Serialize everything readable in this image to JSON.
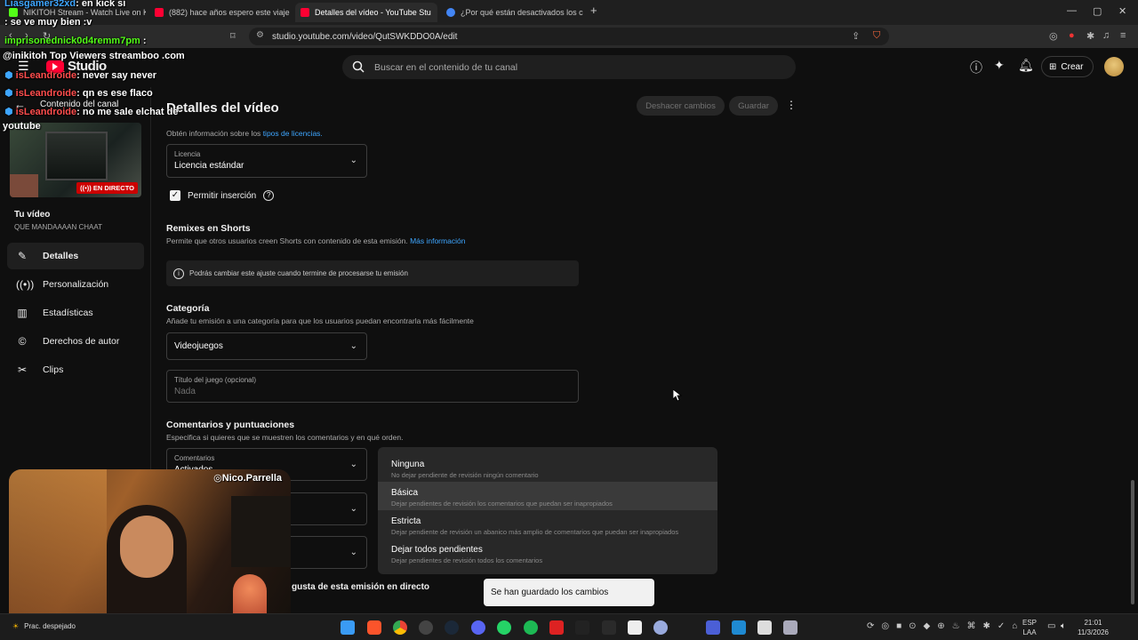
{
  "browser": {
    "tabs": [
      {
        "label": "NIKITOH Stream - Watch Live on Kick"
      },
      {
        "label": "(882) hace años espero este viaje - c"
      },
      {
        "label": "Detalles del vídeo - YouTube Stu"
      },
      {
        "label": "¿Por qué están desactivados los com"
      }
    ],
    "url": "studio.youtube.com/video/QutSWKDDO0A/edit"
  },
  "header": {
    "logo_text": "Studio",
    "search_placeholder": "Buscar en el contenido de tu canal",
    "create_label": "Crear"
  },
  "sidebar": {
    "back_label": "Contenido del canal",
    "live_badge": "EN DIRECTO",
    "your_video_label": "Tu vídeo",
    "video_title": "QUE MANDAAAAN CHAAT",
    "items": [
      {
        "label": "Detalles",
        "icon": "pencil-icon"
      },
      {
        "label": "Personalización",
        "icon": "broadcast-icon"
      },
      {
        "label": "Estadísticas",
        "icon": "analytics-icon"
      },
      {
        "label": "Derechos de autor",
        "icon": "copyright-icon"
      },
      {
        "label": "Clips",
        "icon": "scissors-icon"
      }
    ]
  },
  "main": {
    "page_title": "Detalles del vídeo",
    "undo_label": "Deshacer cambios",
    "save_label": "Guardar",
    "license_info_prefix": "Obtén información sobre los",
    "license_info_link": "tipos de licencias.",
    "license": {
      "label": "Licencia",
      "value": "Licencia estándar"
    },
    "embed_label": "Permitir inserción",
    "remix": {
      "title": "Remixes en Shorts",
      "desc": "Permite que otros usuarios creen Shorts con contenido de esta emisión.",
      "link": "Más información",
      "notice": "Podrás cambiar este ajuste cuando termine de procesarse tu emisión"
    },
    "category": {
      "title": "Categoría",
      "desc": "Añade tu emisión a una categoría para que los usuarios puedan encontrarla más fácilmente",
      "value": "Videojuegos",
      "game_label": "Título del juego (opcional)",
      "game_placeholder": "Nada"
    },
    "comments": {
      "title": "Comentarios y puntuaciones",
      "desc": "Especifica si quieres que se muestren los comentarios y en qué orden.",
      "field_label": "Comentarios",
      "field_value": "Activados",
      "likes_text": "gusta de esta emisión en directo"
    }
  },
  "moderation_menu": [
    {
      "title": "Ninguna",
      "desc": "No dejar pendiente de revisión ningún comentario"
    },
    {
      "title": "Básica",
      "desc": "Dejar pendientes de revisión los comentarios que puedan ser inapropiados"
    },
    {
      "title": "Estricta",
      "desc": "Dejar pendiente de revisión un abanico más amplio de comentarios que puedan ser inapropiados"
    },
    {
      "title": "Dejar todos pendientes",
      "desc": "Dejar pendientes de revisión todos los comentarios"
    }
  ],
  "toast": "Se han guardado los cambios",
  "chat_overlay": [
    {
      "user": "Liasgamer32xd",
      "msg": ": en kick si"
    },
    {
      "user": "",
      "msg": ": se ve muy bien :v"
    },
    {
      "user": "imprisonednick0d4remm7pm",
      "msg": " :"
    },
    {
      "user": "",
      "msg": "@inikitoh Top Viewers streamboo .com"
    },
    {
      "user": "isLeandroide",
      "msg": ": never say never"
    },
    {
      "user": "isLeandroide",
      "msg": ": qn es ese flaco"
    },
    {
      "user": "isLeandroide",
      "msg": ": no me sale elchat de"
    },
    {
      "user": "",
      "msg": "youtube"
    }
  ],
  "webcam_tag": "Nico.Parrella",
  "taskbar": {
    "weather": "Prac. despejado",
    "lang1": "ESP",
    "lang2": "LAA",
    "time": "21:01",
    "date": "11/3/2026"
  }
}
